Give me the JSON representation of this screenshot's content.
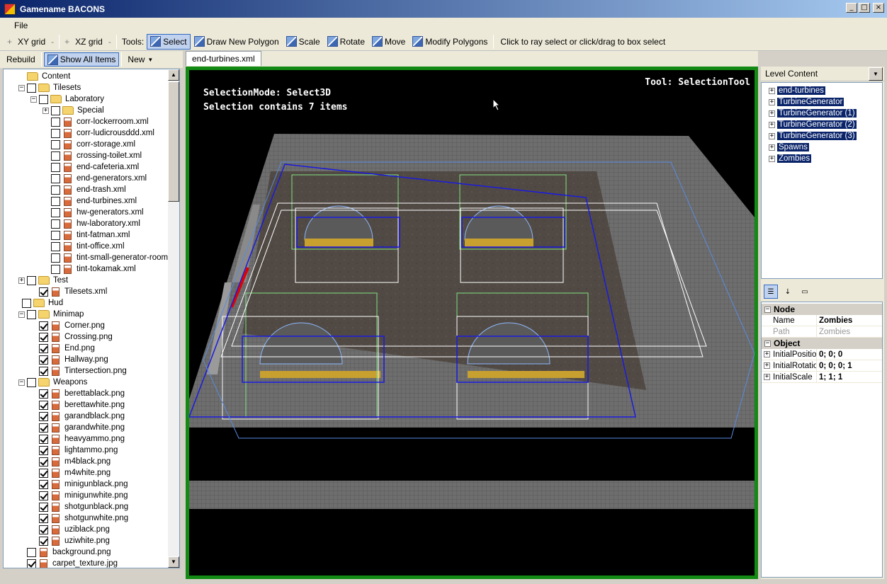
{
  "window": {
    "title": "Gamename BACONS"
  },
  "menu": {
    "file": "File"
  },
  "toolbar": {
    "xy_plus": "+",
    "xy_label": "XY grid",
    "xy_minus": "-",
    "xz_plus": "+",
    "xz_label": "XZ grid",
    "xz_minus": "-",
    "tools_label": "Tools:",
    "select": "Select",
    "draw_polygon": "Draw New Polygon",
    "scale": "Scale",
    "rotate": "Rotate",
    "move": "Move",
    "modify_polygons": "Modify Polygons",
    "hint": "Click to ray select or click/drag to box select"
  },
  "left_toolbar": {
    "rebuild": "Rebuild",
    "show_all": "Show All Items",
    "new": "New"
  },
  "tree": {
    "content": "Content",
    "tilesets": "Tilesets",
    "laboratory": "Laboratory",
    "special": "Special",
    "lab_files": [
      "corr-lockerroom.xml",
      "corr-ludicrousddd.xml",
      "corr-storage.xml",
      "crossing-toilet.xml",
      "end-cafeteria.xml",
      "end-generators.xml",
      "end-trash.xml",
      "end-turbines.xml",
      "hw-generators.xml",
      "hw-laboratory.xml",
      "tint-fatman.xml",
      "tint-office.xml",
      "tint-small-generator-room.xml",
      "tint-tokamak.xml"
    ],
    "test": "Test",
    "tilesets_xml": "Tilesets.xml",
    "hud": "Hud",
    "minimap": "Minimap",
    "minimap_files": [
      "Corner.png",
      "Crossing.png",
      "End.png",
      "Hallway.png",
      "Tintersection.png"
    ],
    "weapons": "Weapons",
    "weapon_files": [
      "berettablack.png",
      "berettawhite.png",
      "garandblack.png",
      "garandwhite.png",
      "heavyammo.png",
      "lightammo.png",
      "m4black.png",
      "m4white.png",
      "minigunblack.png",
      "minigunwhite.png",
      "shotgunblack.png",
      "shotgunwhite.png",
      "uziblack.png",
      "uziwhite.png"
    ],
    "background": "background.png",
    "carpet": "carpet_texture.jpg"
  },
  "doc_tab": "end-turbines.xml",
  "viewport": {
    "tool": "Tool: SelectionTool",
    "mode": "SelectionMode: Select3D",
    "selection": "Selection contains 7 items"
  },
  "level_content": {
    "header": "Level Content",
    "items": [
      "end-turbines",
      "TurbineGenerator",
      "TurbineGenerator (1)",
      "TurbineGenerator (2)",
      "TurbineGenerator (3)",
      "Spawns",
      "Zombies"
    ]
  },
  "properties": {
    "node_cat": "Node",
    "name_label": "Name",
    "name_value": "Zombies",
    "path_label": "Path",
    "path_value": "Zombies",
    "object_cat": "Object",
    "pos_label": "InitialPositio",
    "pos_value": "0; 0; 0",
    "rot_label": "InitialRotatio",
    "rot_value": "0; 0; 0; 1",
    "scale_label": "InitialScale",
    "scale_value": "1; 1; 1"
  },
  "colors": {
    "selection_blue": "#1a1ae0",
    "wire_green": "#7fe07f",
    "frame_green": "#138a13"
  }
}
